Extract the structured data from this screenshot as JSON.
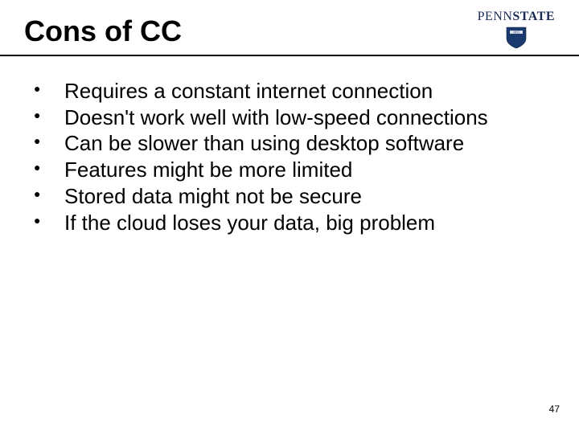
{
  "header": {
    "title": "Cons of CC",
    "logo": {
      "name_thin": "PENN",
      "name_bold": "STATE",
      "shield_year": "1855"
    }
  },
  "bullets": [
    "Requires a constant internet connection",
    "Doesn't work well with low-speed connections",
    "Can be slower than using desktop software",
    "Features might be more limited",
    "Stored data might not be secure",
    "If the cloud loses your data, big problem"
  ],
  "page_number": "47"
}
